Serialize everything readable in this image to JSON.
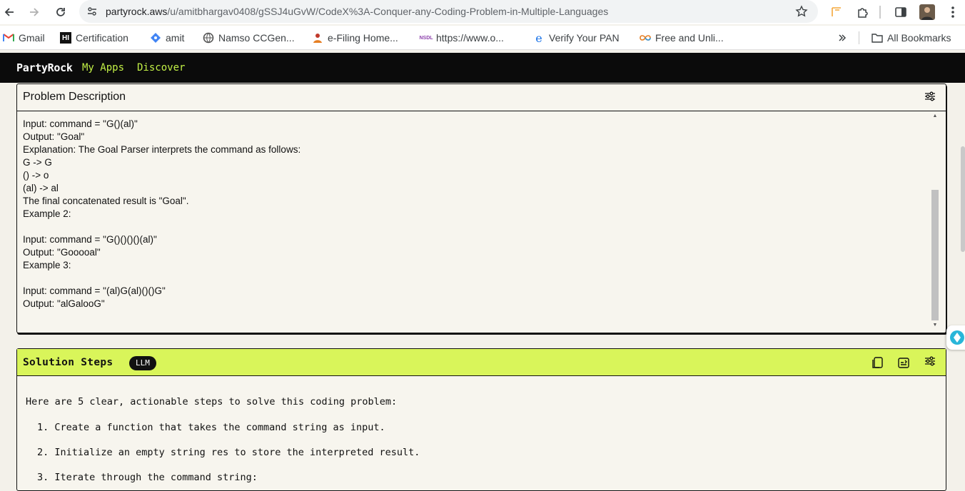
{
  "browser": {
    "url_domain": "partyrock.aws",
    "url_path": "/u/amitbhargav0408/gSSJ4uGvW/CodeX%3A-Conquer-any-Coding-Problem-in-Multiple-Languages"
  },
  "bookmarks": {
    "items": [
      {
        "label": "Gmail",
        "icon": "gmail-icon"
      },
      {
        "label": "Certification",
        "icon": "certification-icon"
      },
      {
        "label": "amit",
        "icon": "amit-icon"
      },
      {
        "label": "Namso CCGen...",
        "icon": "namso-icon"
      },
      {
        "label": "e-Filing Home...",
        "icon": "efiling-icon"
      },
      {
        "label": "https://www.o...",
        "icon": "nsdl-icon"
      },
      {
        "label": "Verify Your PAN",
        "icon": "pan-icon"
      },
      {
        "label": "Free and Unli...",
        "icon": "infinity-icon"
      }
    ],
    "all_label": "All Bookmarks"
  },
  "app_nav": {
    "brand": "PartyRock",
    "links": [
      "My Apps",
      "Discover"
    ],
    "link_color": "#c2f046"
  },
  "problem_card": {
    "title": "Problem Description",
    "lines": [
      "Input: command = \"G()(al)\"",
      "Output: \"Goal\"",
      "Explanation: The Goal Parser interprets the command as follows:",
      "G -> G",
      "() -> o",
      "(al) -> al",
      "The final concatenated result is \"Goal\".",
      "Example 2:",
      "",
      "Input: command = \"G()()()()(al)\"",
      "Output: \"Gooooal\"",
      "Example 3:",
      "",
      "Input: command = \"(al)G(al)()()G\"",
      "Output: \"alGalooG\""
    ]
  },
  "solution_card": {
    "title": "Solution Steps",
    "badge": "LLM",
    "accent": "#d9f55a",
    "intro": "Here are 5 clear, actionable steps to solve this coding problem:",
    "steps": [
      "1. Create a function that takes the command string as input.",
      "2. Initialize an empty string res to store the interpreted result.",
      "3. Iterate through the command string:"
    ]
  }
}
